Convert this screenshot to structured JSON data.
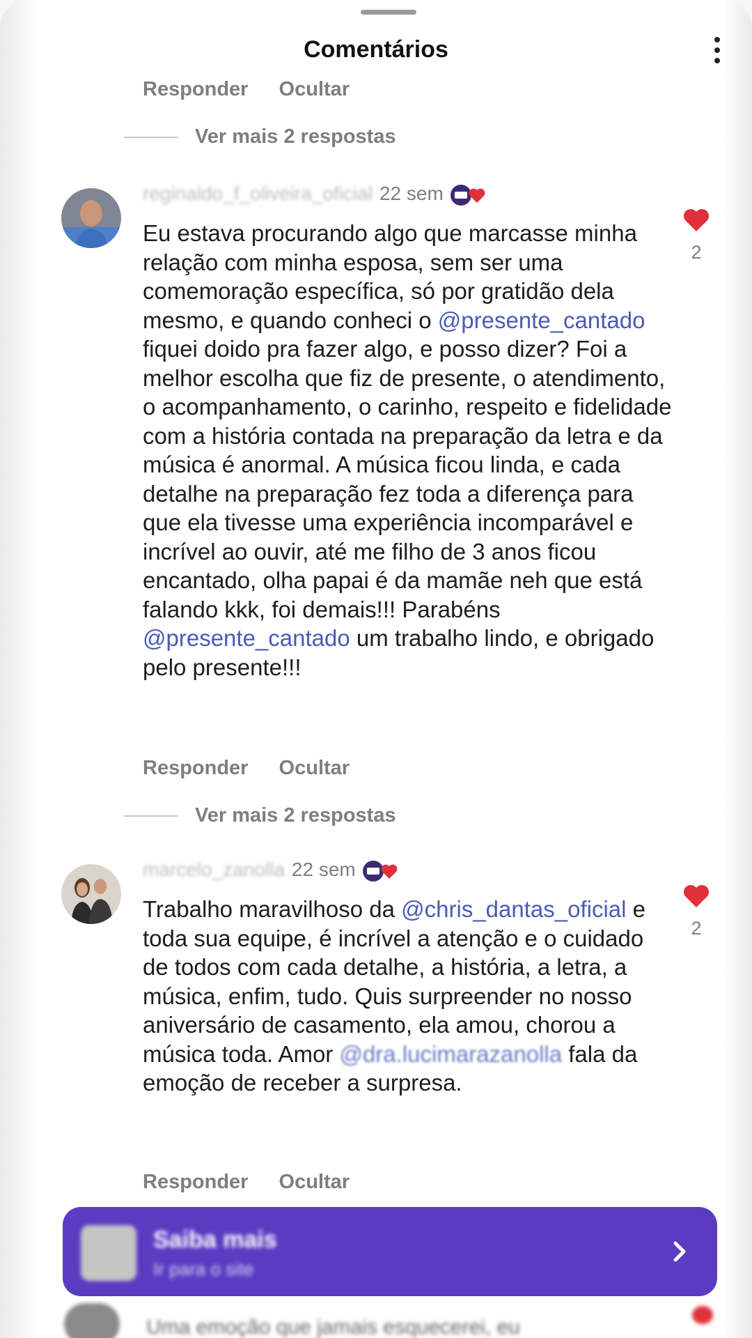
{
  "header": {
    "title": "Comentários"
  },
  "top_actions": {
    "reply": "Responder",
    "hide": "Ocultar"
  },
  "top_more_replies": "Ver mais 2 respostas",
  "comments": [
    {
      "username": "reginaldo_f_oliveira_oficial",
      "time": "22 sem",
      "text_parts": [
        "Eu estava procurando algo que marcasse minha relação com minha esposa, sem ser uma comemoração específica, só por gratidão dela mesmo, e quando conheci o ",
        "@presente_cantado",
        " fiquei doido pra fazer algo, e posso dizer? Foi a melhor escolha que fiz de presente, o atendimento, o acompanhamento, o carinho, respeito e fidelidade com a história contada na preparação da letra e da música é anormal. A música ficou linda, e cada detalhe na preparação fez toda a diferença para que ela tivesse uma experiência incomparável e incrível ao ouvir, até me filho de 3 anos ficou encantado, olha papai é da mamãe neh que está falando kkk, foi demais!!! Parabéns ",
        "@presente_cantado",
        " um trabalho lindo, e obrigado pelo presente!!!"
      ],
      "likes": "2",
      "reply": "Responder",
      "hide": "Ocultar",
      "more_replies": "Ver mais 2 respostas"
    },
    {
      "username": "marcelo_zanolla",
      "time": "22 sem",
      "text_parts": [
        "Trabalho maravilhoso da ",
        "@chris_dantas_oficial",
        " e toda sua equipe, é incrível a atenção e o cuidado de todos com cada detalhe, a história, a letra, a música, enfim, tudo. Quis surpreender no nosso aniversário de casamento, ela amou, chorou a música toda. Amor ",
        "@dra.lucimarazanolla",
        " fala da emoção de receber a surpresa."
      ],
      "likes": "2",
      "reply": "Responder",
      "hide": "Ocultar"
    }
  ],
  "cta": {
    "title": "Saiba mais",
    "subtitle": "Ir para o site"
  },
  "bottom_peek": {
    "text": "Uma emoção que jamais esquecerei, eu"
  },
  "colors": {
    "accent_purple": "#5a3cc3",
    "mention_blue": "#4a5bb5",
    "like_red": "#e0303a",
    "muted_gray": "#7e7e7e"
  },
  "icons": {
    "menu": "more-vertical-icon",
    "like": "heart-icon",
    "badge": "verified-fan-badge-icon",
    "cta": "chevron-right-icon"
  }
}
